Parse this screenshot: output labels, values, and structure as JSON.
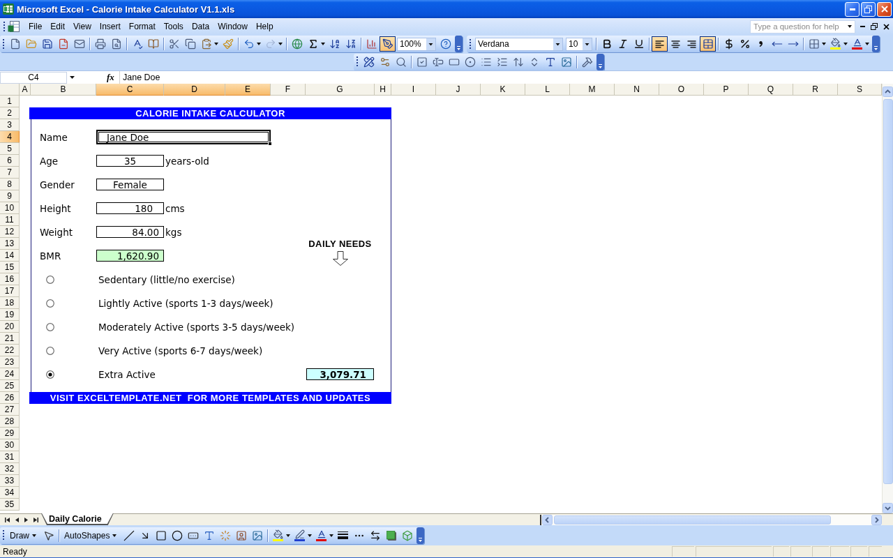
{
  "window": {
    "title": "Microsoft Excel - Calorie Intake Calculator V1.1.xls"
  },
  "menu_bar": {
    "items": [
      "File",
      "Edit",
      "View",
      "Insert",
      "Format",
      "Tools",
      "Data",
      "Window",
      "Help"
    ],
    "help_search": {
      "placeholder": "Type a question for help"
    }
  },
  "standard_toolbar": {
    "redo_disabled": true,
    "drawing_active": true,
    "zoom": "100%"
  },
  "formatting_toolbar": {
    "font": "Verdana",
    "font_size": "10",
    "bold": false,
    "italic": false,
    "underline": false,
    "align_left": true,
    "center": false,
    "align_right": false,
    "merge_and_center": true
  },
  "formula_bar": {
    "name_box": "C4",
    "function_button": "fx",
    "content": "Jane Doe"
  },
  "sheet": {
    "columns": [
      {
        "label": "A",
        "selected": false
      },
      {
        "label": "B",
        "selected": false
      },
      {
        "label": "C",
        "selected": true
      },
      {
        "label": "D",
        "selected": true
      },
      {
        "label": "E",
        "selected": true
      },
      {
        "label": "F",
        "selected": false
      },
      {
        "label": "G",
        "selected": false
      },
      {
        "label": "H",
        "selected": false
      },
      {
        "label": "I",
        "selected": false
      },
      {
        "label": "J",
        "selected": false
      },
      {
        "label": "K",
        "selected": false
      },
      {
        "label": "L",
        "selected": false
      },
      {
        "label": "M",
        "selected": false
      },
      {
        "label": "N",
        "selected": false
      },
      {
        "label": "O",
        "selected": false
      },
      {
        "label": "P",
        "selected": false
      },
      {
        "label": "Q",
        "selected": false
      },
      {
        "label": "R",
        "selected": false
      },
      {
        "label": "S",
        "selected": false
      }
    ],
    "rows": [
      {
        "label": "1",
        "selected": false
      },
      {
        "label": "2",
        "selected": false
      },
      {
        "label": "3",
        "selected": false
      },
      {
        "label": "4",
        "selected": true
      },
      {
        "label": "5",
        "selected": false
      },
      {
        "label": "6",
        "selected": false
      },
      {
        "label": "7",
        "selected": false
      },
      {
        "label": "8",
        "selected": false
      },
      {
        "label": "9",
        "selected": false
      },
      {
        "label": "10",
        "selected": false
      },
      {
        "label": "11",
        "selected": false
      },
      {
        "label": "12",
        "selected": false
      },
      {
        "label": "13",
        "selected": false
      },
      {
        "label": "14",
        "selected": false
      },
      {
        "label": "15",
        "selected": false
      },
      {
        "label": "16",
        "selected": false
      },
      {
        "label": "17",
        "selected": false
      },
      {
        "label": "18",
        "selected": false
      },
      {
        "label": "19",
        "selected": false
      },
      {
        "label": "20",
        "selected": false
      },
      {
        "label": "21",
        "selected": false
      },
      {
        "label": "22",
        "selected": false
      },
      {
        "label": "23",
        "selected": false
      },
      {
        "label": "24",
        "selected": false
      },
      {
        "label": "25",
        "selected": false
      },
      {
        "label": "26",
        "selected": false
      },
      {
        "label": "27",
        "selected": false
      },
      {
        "label": "28",
        "selected": false
      },
      {
        "label": "29",
        "selected": false
      },
      {
        "label": "30",
        "selected": false
      },
      {
        "label": "31",
        "selected": false
      },
      {
        "label": "32",
        "selected": false
      },
      {
        "label": "33",
        "selected": false
      },
      {
        "label": "34",
        "selected": false
      },
      {
        "label": "35",
        "selected": false
      }
    ],
    "form": {
      "title": "CALORIE INTAKE CALCULATOR",
      "fields": [
        {
          "label": "Name",
          "value": "Jane Doe",
          "kind": "text",
          "selected": true
        },
        {
          "label": "Age",
          "value": "35",
          "unit": "years-old",
          "kind": "number",
          "selected": false
        },
        {
          "label": "Gender",
          "value": "Female",
          "kind": "choice",
          "selected": false
        },
        {
          "label": "Height",
          "value": "180",
          "unit": "cms",
          "kind": "number",
          "selected": false
        },
        {
          "label": "Weight",
          "value": "84.00",
          "unit": "kgs",
          "kind": "number",
          "selected": false
        },
        {
          "label": "BMR",
          "value": "1,620.90",
          "kind": "result",
          "selected": false
        }
      ],
      "activity_levels": [
        {
          "label": "Sedentary (little/no exercise)",
          "selected": false
        },
        {
          "label": "Lightly Active (sports 1-3 days/week)",
          "selected": false
        },
        {
          "label": "Moderately Active (sports 3-5 days/week)",
          "selected": false
        },
        {
          "label": "Very Active (sports 6-7 days/week)",
          "selected": false
        },
        {
          "label": "Extra Active",
          "selected": true
        }
      ],
      "daily_needs": {
        "title": "DAILY NEEDS",
        "value": "3,079.71"
      },
      "footer": "VISIT EXCELTEMPLATE.NET  FOR MORE TEMPLATES AND UPDATES"
    }
  },
  "sheet_tabs": [
    {
      "label": "Daily Calorie",
      "selected": true
    }
  ],
  "drawing_toolbar": {
    "draw_menu": "Draw",
    "autoshapes_menu": "AutoShapes"
  },
  "status_bar": {
    "text": "Ready"
  }
}
